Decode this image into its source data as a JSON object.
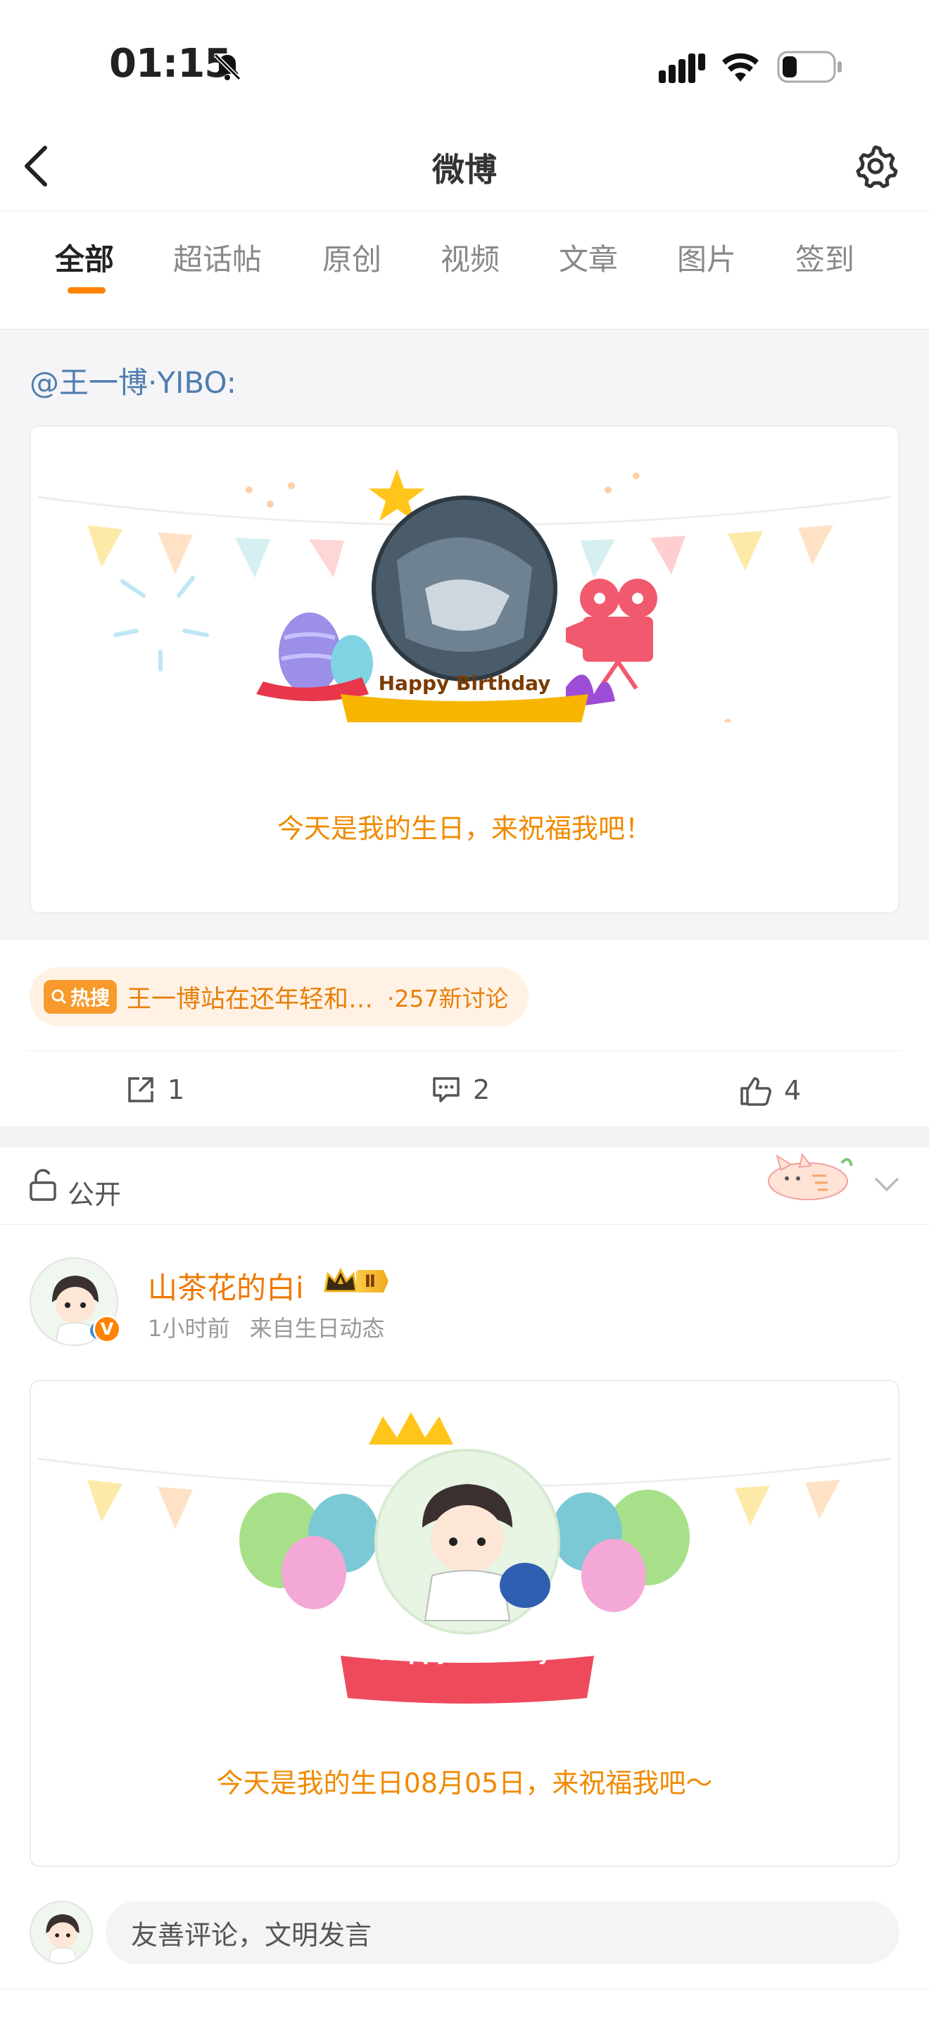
{
  "status_bar": {
    "time": "01:15"
  },
  "header": {
    "title": "微博"
  },
  "tabs": [
    {
      "label": "全部"
    },
    {
      "label": "超话帖"
    },
    {
      "label": "原创"
    },
    {
      "label": "视频"
    },
    {
      "label": "文章"
    },
    {
      "label": "图片"
    },
    {
      "label": "签到"
    }
  ],
  "repost": {
    "author": "@王一博·YIBO:",
    "card_banner": "Happy Birthday",
    "card_text": "今天是我的生日，来祝福我吧！"
  },
  "hot_search": {
    "badge": "热搜",
    "text": "王一博站在还年轻和…",
    "count": "·257新讨论"
  },
  "actions": {
    "repost_count": "1",
    "comment_count": "2",
    "like_count": "4"
  },
  "visibility": {
    "label": "公开"
  },
  "comment": {
    "user": "山茶花的白i",
    "level_badge": "Ⅱ",
    "verified": "V",
    "time": "1小时前",
    "source": "来自生日动态",
    "card_banner": "Happy Birthday",
    "card_text": "今天是我的生日08月05日，来祝福我吧～"
  },
  "comment_input": {
    "placeholder": "友善评论，文明发言"
  },
  "colors": {
    "accent": "#ff8200",
    "link": "#507daf",
    "card_text": "#f08a00"
  }
}
